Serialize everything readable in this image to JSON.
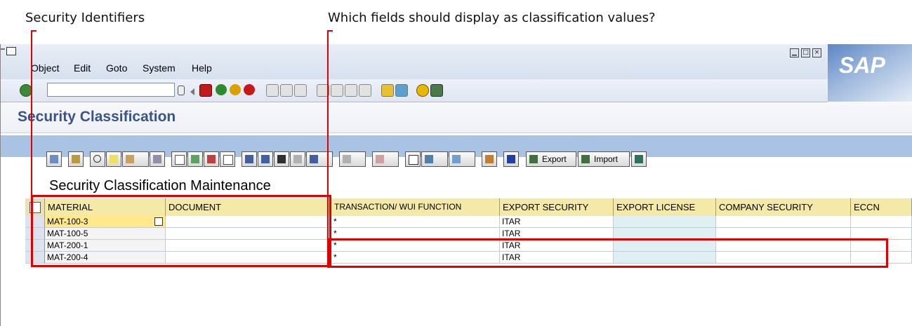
{
  "annotations": {
    "left_label": "Security Identifiers",
    "right_label": "Which fields should display as classification values?"
  },
  "window": {
    "menu": [
      {
        "label": "Object",
        "ul": "O"
      },
      {
        "label": "Edit"
      },
      {
        "label": "Goto"
      },
      {
        "label": "System"
      },
      {
        "label": "Help"
      }
    ],
    "logo_text": "SAP"
  },
  "toolbar": {
    "okcode_value": "",
    "icons": [
      "enter-icon",
      "dropdown-icon",
      "back-arrow-icon",
      "save-icon",
      "back-icon",
      "exit-icon",
      "cancel-icon",
      "print-icon",
      "find-icon",
      "find-next-icon",
      "first-page-icon",
      "previous-page-icon",
      "next-page-icon",
      "last-page-icon",
      "create-session-icon",
      "shortcut-icon",
      "help-icon",
      "layout-icon"
    ]
  },
  "page": {
    "title": "Security Classification"
  },
  "alv": {
    "export_label": "Export",
    "import_label": "Import",
    "grid_title": "Security Classification Maintenance",
    "columns": [
      "MATERIAL",
      "DOCUMENT",
      "TRANSACTION/ WUI FUNCTION",
      "EXPORT SECURITY",
      "EXPORT LICENSE",
      "COMPANY SECURITY",
      "ECCN"
    ],
    "rows": [
      [
        "MAT-100-3",
        "",
        "*",
        "ITAR",
        "",
        "",
        ""
      ],
      [
        "MAT-100-5",
        "",
        "*",
        "ITAR",
        "",
        "",
        ""
      ],
      [
        "MAT-200-1",
        "",
        "*",
        "ITAR",
        "",
        "",
        ""
      ],
      [
        "MAT-200-4",
        "",
        "*",
        "ITAR",
        "",
        "",
        ""
      ]
    ]
  },
  "colors": {
    "highlight_red": "#e00000",
    "header_yellow": "#f5e9a8",
    "title_blue": "#385489"
  }
}
